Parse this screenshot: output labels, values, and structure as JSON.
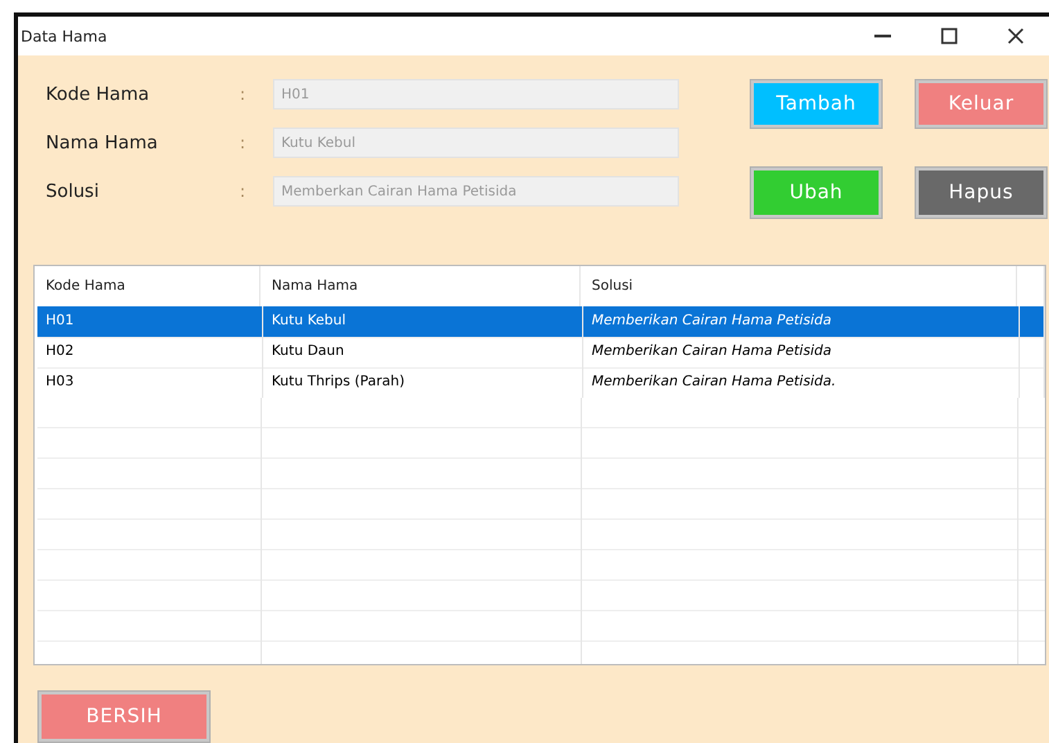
{
  "window": {
    "title": "Data Hama"
  },
  "fields": [
    {
      "label": "Kode Hama",
      "colon": ":",
      "value": "H01"
    },
    {
      "label": "Nama Hama",
      "colon": ":",
      "value": "Kutu Kebul"
    },
    {
      "label": "Solusi",
      "colon": ":",
      "value": "Memberkan Cairan Hama Petisida"
    }
  ],
  "buttons": [
    {
      "label": "Tambah",
      "color": "#00bfff"
    },
    {
      "label": "Keluar",
      "color": "#f08080"
    },
    {
      "label": "Ubah",
      "color": "#32cd32"
    },
    {
      "label": "Hapus",
      "color": "#696969"
    }
  ],
  "table": {
    "columns": [
      "Kode Hama",
      "Nama Hama",
      "Solusi"
    ],
    "rows": [
      {
        "cells": [
          "H01",
          "Kutu Kebul",
          "Memberikan Cairan Hama Petisida"
        ],
        "selected": true
      },
      {
        "cells": [
          "H02",
          "Kutu Daun",
          "Memberikan Cairan Hama Petisida"
        ],
        "selected": false
      },
      {
        "cells": [
          "H03",
          "Kutu Thrips (Parah)",
          "Memberikan Cairan Hama Petisida."
        ],
        "selected": false
      }
    ]
  },
  "clear_button": {
    "label": "BERSIH",
    "color": "#f08080"
  }
}
